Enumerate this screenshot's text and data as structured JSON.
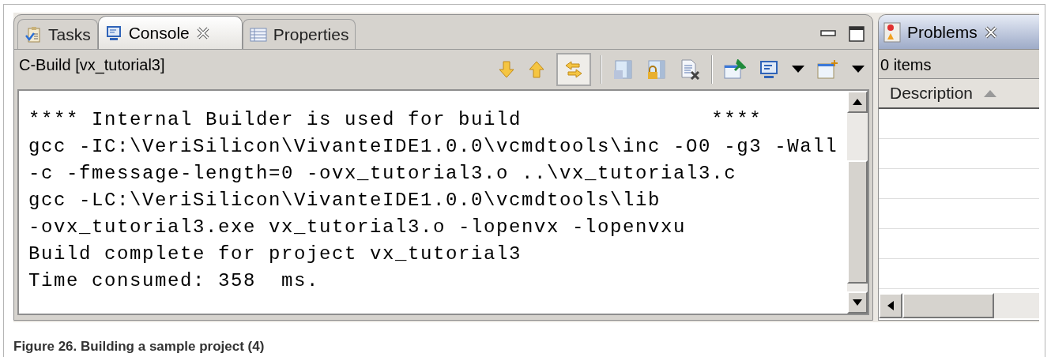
{
  "console_view": {
    "tabs": [
      {
        "label": "Tasks",
        "kind": "tasks",
        "selected": false,
        "closable": false
      },
      {
        "label": "Console",
        "kind": "console",
        "selected": true,
        "closable": true
      },
      {
        "label": "Properties",
        "kind": "properties",
        "selected": false,
        "closable": false
      }
    ],
    "title": "C-Build [vx_tutorial3]",
    "toolbar": [
      {
        "kind": "down"
      },
      {
        "kind": "up"
      },
      {
        "kind": "swap",
        "pressed": true
      },
      {
        "kind": "separator"
      },
      {
        "kind": "save"
      },
      {
        "kind": "lock"
      },
      {
        "kind": "clear"
      },
      {
        "kind": "separator"
      },
      {
        "kind": "pin"
      },
      {
        "kind": "monitor"
      },
      {
        "kind": "caret"
      },
      {
        "kind": "newwin"
      },
      {
        "kind": "caret"
      }
    ],
    "lines": [
      "**** Internal Builder is used for build               ****",
      "gcc -IC:\\VeriSilicon\\VivanteIDE1.0.0\\vcmdtools\\inc -O0 -g3 -Wall",
      "-c -fmessage-length=0 -ovx_tutorial3.o ..\\vx_tutorial3.c",
      "gcc -LC:\\VeriSilicon\\VivanteIDE1.0.0\\vcmdtools\\lib",
      "-ovx_tutorial3.exe vx_tutorial3.o -lopenvx -lopenvxu",
      "Build complete for project vx_tutorial3",
      "Time consumed: 358  ms."
    ]
  },
  "problems_view": {
    "tabs": [
      {
        "label": "Problems",
        "selected": true,
        "closable": true
      }
    ],
    "count": "0 items",
    "columns": [
      {
        "label": "Description",
        "sort_ascending": true
      }
    ]
  },
  "caption": "Figure 26.  Building a sample project (4)"
}
